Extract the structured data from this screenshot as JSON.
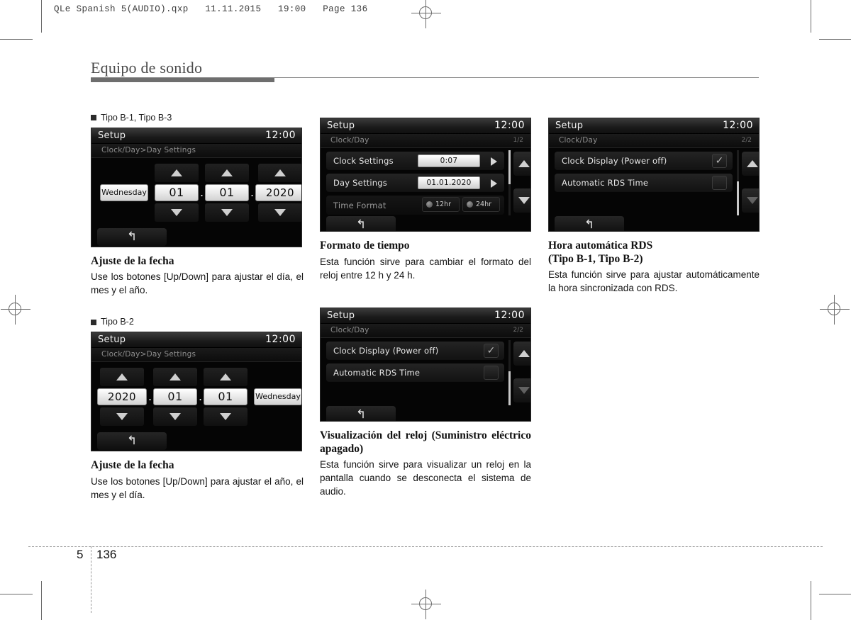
{
  "print_header": "QLe Spanish 5(AUDIO).qxp   11.11.2015   19:00   Page 136",
  "page_title": "Equipo de sonido",
  "footer": {
    "chapter": "5",
    "page": "136"
  },
  "icons": {
    "back": "↱",
    "check": "✓",
    "bullet": "square-bullet"
  },
  "columns": {
    "left": {
      "block1": {
        "tipo": "Tipo B-1, Tipo B-3",
        "screen": {
          "title": "Setup",
          "clock": "12:00",
          "breadcrumb": "Clock/Day>Day Settings",
          "weekday": "Wednesday",
          "day": "01",
          "month": "01",
          "year": "2020",
          "separator": "."
        },
        "caption_head": "Ajuste de la fecha",
        "caption_body": "Use los botones [Up/Down] para ajustar el día, el mes y el año."
      },
      "block2": {
        "tipo": "Tipo B-2",
        "screen": {
          "title": "Setup",
          "clock": "12:00",
          "breadcrumb": "Clock/Day>Day Settings",
          "year": "2020",
          "month": "01",
          "day": "01",
          "weekday": "Wednesday",
          "separator": "."
        },
        "caption_head": "Ajuste de la fecha",
        "caption_body": "Use los botones [Up/Down] para ajustar el año, el mes y el día."
      }
    },
    "middle": {
      "block1": {
        "screen": {
          "title": "Setup",
          "clock": "12:00",
          "breadcrumb": "Clock/Day",
          "page_indicator": "1/2",
          "rows": [
            {
              "label": "Clock Settings",
              "value": "0:07",
              "control": "value-arrow"
            },
            {
              "label": "Day Settings",
              "value": "01.01.2020",
              "control": "value-arrow"
            },
            {
              "label": "Time Format",
              "control": "radio",
              "options": [
                "12hr",
                "24hr"
              ]
            }
          ]
        },
        "caption_head": "Formato de tiempo",
        "caption_body": "Esta función sirve para cambiar el formato del reloj entre 12 h y 24 h."
      },
      "block2": {
        "screen": {
          "title": "Setup",
          "clock": "12:00",
          "breadcrumb": "Clock/Day",
          "page_indicator": "2/2",
          "rows": [
            {
              "label": "Clock Display (Power off)",
              "control": "checkbox",
              "checked": true
            },
            {
              "label": "Automatic RDS Time",
              "control": "checkbox",
              "checked": false
            }
          ]
        },
        "caption_head": "Visualización del reloj (Suministro eléctrico apagado)",
        "caption_body": "Esta función sirve para visualizar un reloj en la pantalla cuando se desconecta el sistema de audio."
      }
    },
    "right": {
      "block1": {
        "screen": {
          "title": "Setup",
          "clock": "12:00",
          "breadcrumb": "Clock/Day",
          "page_indicator": "2/2",
          "rows": [
            {
              "label": "Clock Display (Power off)",
              "control": "checkbox",
              "checked": true
            },
            {
              "label": "Automatic RDS Time",
              "control": "checkbox",
              "checked": false
            }
          ]
        },
        "caption_head_line1": "Hora automática RDS",
        "caption_head_line2": "(Tipo B-1, Tipo B-2)",
        "caption_body": "Esta función sirve para ajustar automáticamente la hora sincronizada con RDS."
      }
    }
  }
}
